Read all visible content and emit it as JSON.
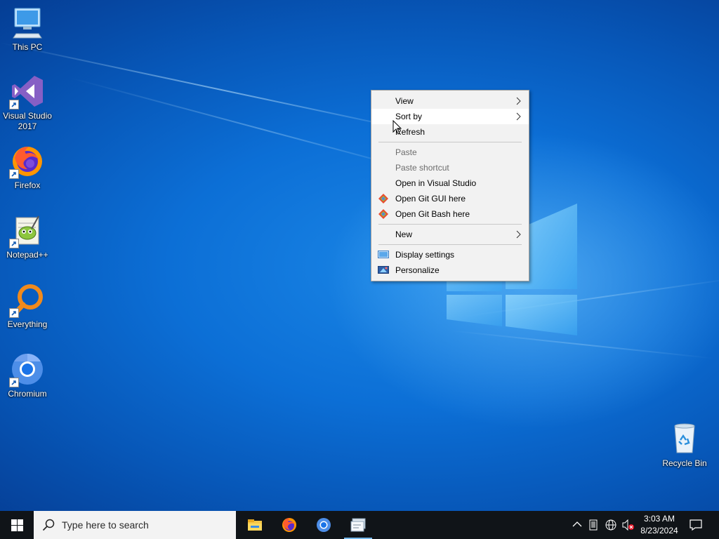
{
  "desktop": {
    "icons": [
      {
        "id": "this-pc",
        "label": "This PC",
        "icon": "computer-icon"
      },
      {
        "id": "visual-studio",
        "label": "Visual Studio 2017",
        "icon": "visual-studio-icon"
      },
      {
        "id": "firefox",
        "label": "Firefox",
        "icon": "firefox-icon"
      },
      {
        "id": "notepadpp",
        "label": "Notepad++",
        "icon": "notepadpp-icon"
      },
      {
        "id": "everything",
        "label": "Everything",
        "icon": "everything-search-icon"
      },
      {
        "id": "chromium",
        "label": "Chromium",
        "icon": "chromium-icon"
      },
      {
        "id": "recycle-bin",
        "label": "Recycle Bin",
        "icon": "recycle-bin-icon"
      }
    ]
  },
  "context_menu": {
    "items": [
      {
        "label": "View",
        "submenu": true,
        "state": "normal"
      },
      {
        "label": "Sort by",
        "submenu": true,
        "state": "hover"
      },
      {
        "label": "Refresh",
        "submenu": false,
        "state": "normal"
      },
      {
        "label": "Paste",
        "submenu": false,
        "state": "disabled"
      },
      {
        "label": "Paste shortcut",
        "submenu": false,
        "state": "disabled"
      },
      {
        "label": "Open in Visual Studio",
        "submenu": false,
        "state": "normal"
      },
      {
        "label": "Open Git GUI here",
        "submenu": false,
        "state": "normal",
        "icon": "git-icon"
      },
      {
        "label": "Open Git Bash here",
        "submenu": false,
        "state": "normal",
        "icon": "git-icon"
      },
      {
        "label": "New",
        "submenu": true,
        "state": "normal"
      },
      {
        "label": "Display settings",
        "submenu": false,
        "state": "normal",
        "icon": "display-settings-icon"
      },
      {
        "label": "Personalize",
        "submenu": false,
        "state": "normal",
        "icon": "personalize-icon"
      }
    ]
  },
  "taskbar": {
    "search_placeholder": "Type here to search",
    "pinned_apps": [
      "file-explorer-icon",
      "firefox-icon",
      "chromium-icon",
      "desktop-app-icon"
    ],
    "tray": {
      "time": "3:03 AM",
      "date": "8/23/2024",
      "icons": [
        "chevron-up-icon",
        "tablet-icon",
        "network-icon",
        "volume-muted-icon",
        "notification-icon"
      ]
    }
  },
  "colors": {
    "wallpaper": "#0c6fd6",
    "taskbar": "#101418",
    "menu_bg": "#f2f2f2",
    "menu_hover": "#ffffff",
    "disabled_text": "#6d6d6d"
  }
}
